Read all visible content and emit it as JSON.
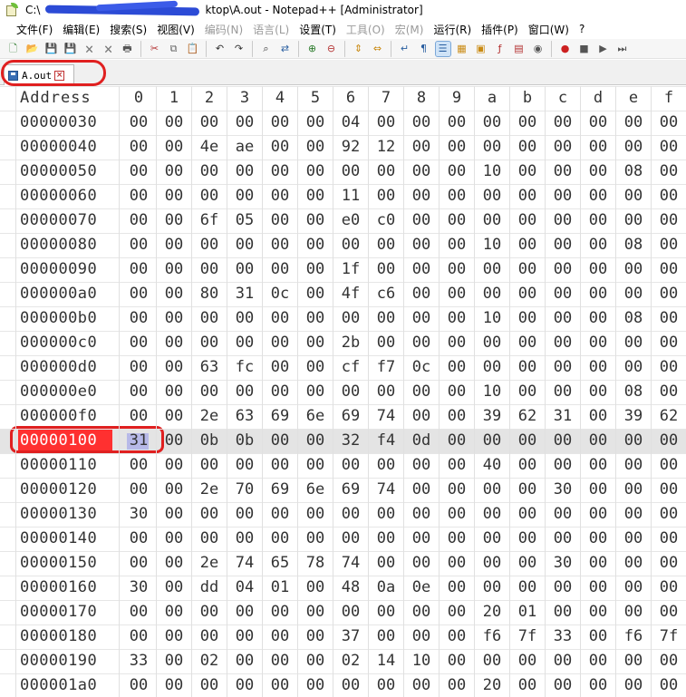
{
  "window": {
    "title_prefix": "C:\\",
    "title_suffix": "ktop\\A.out - Notepad++ [Administrator]"
  },
  "menu": [
    {
      "label": "文件(F)",
      "disabled": false
    },
    {
      "label": "编辑(E)",
      "disabled": false
    },
    {
      "label": "搜索(S)",
      "disabled": false
    },
    {
      "label": "视图(V)",
      "disabled": false
    },
    {
      "label": "编码(N)",
      "disabled": true
    },
    {
      "label": "语言(L)",
      "disabled": true
    },
    {
      "label": "设置(T)",
      "disabled": false
    },
    {
      "label": "工具(O)",
      "disabled": true
    },
    {
      "label": "宏(M)",
      "disabled": true
    },
    {
      "label": "运行(R)",
      "disabled": false
    },
    {
      "label": "插件(P)",
      "disabled": false
    },
    {
      "label": "窗口(W)",
      "disabled": false
    },
    {
      "label": "?",
      "disabled": false
    }
  ],
  "toolbar": [
    {
      "name": "new-file-icon",
      "glyph": "🗋",
      "color": "#2d7a2d"
    },
    {
      "name": "open-file-icon",
      "glyph": "📂",
      "color": "#c98a12"
    },
    {
      "name": "save-icon",
      "glyph": "💾",
      "color": "#7a7a7a"
    },
    {
      "name": "save-all-icon",
      "glyph": "💾",
      "color": "#7a7a7a"
    },
    {
      "name": "close-file-icon",
      "glyph": "🗙",
      "color": "#7a7a7a"
    },
    {
      "name": "close-all-icon",
      "glyph": "🗙",
      "color": "#7a7a7a"
    },
    {
      "name": "print-icon",
      "glyph": "🖶",
      "color": "#555555"
    },
    {
      "name": "sep"
    },
    {
      "name": "cut-icon",
      "glyph": "✂",
      "color": "#b33030"
    },
    {
      "name": "copy-icon",
      "glyph": "⧉",
      "color": "#666666"
    },
    {
      "name": "paste-icon",
      "glyph": "📋",
      "color": "#8a6a2a"
    },
    {
      "name": "sep"
    },
    {
      "name": "undo-icon",
      "glyph": "↶",
      "color": "#333333"
    },
    {
      "name": "redo-icon",
      "glyph": "↷",
      "color": "#333333"
    },
    {
      "name": "sep"
    },
    {
      "name": "find-icon",
      "glyph": "⌕",
      "color": "#333333"
    },
    {
      "name": "replace-icon",
      "glyph": "⇄",
      "color": "#2a5fa0"
    },
    {
      "name": "sep"
    },
    {
      "name": "zoom-in-icon",
      "glyph": "⊕",
      "color": "#2a7a2a"
    },
    {
      "name": "zoom-out-icon",
      "glyph": "⊖",
      "color": "#b33030"
    },
    {
      "name": "sep"
    },
    {
      "name": "sync-vertical-icon",
      "glyph": "⇕",
      "color": "#c98a12"
    },
    {
      "name": "sync-horizontal-icon",
      "glyph": "⇔",
      "color": "#c98a12"
    },
    {
      "name": "sep"
    },
    {
      "name": "word-wrap-icon",
      "glyph": "↵",
      "color": "#2a5fa0"
    },
    {
      "name": "show-all-chars-icon",
      "glyph": "¶",
      "color": "#2a5fa0"
    },
    {
      "name": "indent-guide-icon",
      "glyph": "☰",
      "color": "#2a5fa0",
      "active": true
    },
    {
      "name": "user-lang-icon",
      "glyph": "▦",
      "color": "#c98a12"
    },
    {
      "name": "doc-map-icon",
      "glyph": "▣",
      "color": "#c98a12"
    },
    {
      "name": "function-list-icon",
      "glyph": "ƒ",
      "color": "#b33030"
    },
    {
      "name": "folder-workspace-icon",
      "glyph": "▤",
      "color": "#b33030"
    },
    {
      "name": "monitor-icon",
      "glyph": "◉",
      "color": "#555555"
    },
    {
      "name": "sep"
    },
    {
      "name": "record-macro-icon",
      "glyph": "●",
      "color": "#cc2020"
    },
    {
      "name": "stop-macro-icon",
      "glyph": "■",
      "color": "#555555"
    },
    {
      "name": "play-macro-icon",
      "glyph": "▶",
      "color": "#555555"
    },
    {
      "name": "run-macro-multiple-icon",
      "glyph": "⏭",
      "color": "#555555"
    }
  ],
  "tab": {
    "label": "A.out"
  },
  "hex": {
    "header": [
      "Address",
      "0",
      "1",
      "2",
      "3",
      "4",
      "5",
      "6",
      "7",
      "8",
      "9",
      "a",
      "b",
      "c",
      "d",
      "e",
      "f"
    ],
    "rows": [
      {
        "addr": "00000030",
        "bytes": [
          "00",
          "00",
          "00",
          "00",
          "00",
          "00",
          "04",
          "00",
          "00",
          "00",
          "00",
          "00",
          "00",
          "00",
          "00",
          "00"
        ]
      },
      {
        "addr": "00000040",
        "bytes": [
          "00",
          "00",
          "4e",
          "ae",
          "00",
          "00",
          "92",
          "12",
          "00",
          "00",
          "00",
          "00",
          "00",
          "00",
          "00",
          "00"
        ]
      },
      {
        "addr": "00000050",
        "bytes": [
          "00",
          "00",
          "00",
          "00",
          "00",
          "00",
          "00",
          "00",
          "00",
          "00",
          "10",
          "00",
          "00",
          "00",
          "08",
          "00"
        ]
      },
      {
        "addr": "00000060",
        "bytes": [
          "00",
          "00",
          "00",
          "00",
          "00",
          "00",
          "11",
          "00",
          "00",
          "00",
          "00",
          "00",
          "00",
          "00",
          "00",
          "00"
        ]
      },
      {
        "addr": "00000070",
        "bytes": [
          "00",
          "00",
          "6f",
          "05",
          "00",
          "00",
          "e0",
          "c0",
          "00",
          "00",
          "00",
          "00",
          "00",
          "00",
          "00",
          "00"
        ]
      },
      {
        "addr": "00000080",
        "bytes": [
          "00",
          "00",
          "00",
          "00",
          "00",
          "00",
          "00",
          "00",
          "00",
          "00",
          "10",
          "00",
          "00",
          "00",
          "08",
          "00"
        ]
      },
      {
        "addr": "00000090",
        "bytes": [
          "00",
          "00",
          "00",
          "00",
          "00",
          "00",
          "1f",
          "00",
          "00",
          "00",
          "00",
          "00",
          "00",
          "00",
          "00",
          "00"
        ]
      },
      {
        "addr": "000000a0",
        "bytes": [
          "00",
          "00",
          "80",
          "31",
          "0c",
          "00",
          "4f",
          "c6",
          "00",
          "00",
          "00",
          "00",
          "00",
          "00",
          "00",
          "00"
        ]
      },
      {
        "addr": "000000b0",
        "bytes": [
          "00",
          "00",
          "00",
          "00",
          "00",
          "00",
          "00",
          "00",
          "00",
          "00",
          "10",
          "00",
          "00",
          "00",
          "08",
          "00"
        ]
      },
      {
        "addr": "000000c0",
        "bytes": [
          "00",
          "00",
          "00",
          "00",
          "00",
          "00",
          "2b",
          "00",
          "00",
          "00",
          "00",
          "00",
          "00",
          "00",
          "00",
          "00"
        ]
      },
      {
        "addr": "000000d0",
        "bytes": [
          "00",
          "00",
          "63",
          "fc",
          "00",
          "00",
          "cf",
          "f7",
          "0c",
          "00",
          "00",
          "00",
          "00",
          "00",
          "00",
          "00"
        ]
      },
      {
        "addr": "000000e0",
        "bytes": [
          "00",
          "00",
          "00",
          "00",
          "00",
          "00",
          "00",
          "00",
          "00",
          "00",
          "10",
          "00",
          "00",
          "00",
          "08",
          "00"
        ]
      },
      {
        "addr": "000000f0",
        "bytes": [
          "00",
          "00",
          "2e",
          "63",
          "69",
          "6e",
          "69",
          "74",
          "00",
          "00",
          "39",
          "62",
          "31",
          "00",
          "39",
          "62"
        ]
      },
      {
        "addr": "00000100",
        "bytes": [
          "31",
          "00",
          "0b",
          "0b",
          "00",
          "00",
          "32",
          "f4",
          "0d",
          "00",
          "00",
          "00",
          "00",
          "00",
          "00",
          "00"
        ],
        "highlight": true
      },
      {
        "addr": "00000110",
        "bytes": [
          "00",
          "00",
          "00",
          "00",
          "00",
          "00",
          "00",
          "00",
          "00",
          "00",
          "40",
          "00",
          "00",
          "00",
          "00",
          "00"
        ]
      },
      {
        "addr": "00000120",
        "bytes": [
          "00",
          "00",
          "2e",
          "70",
          "69",
          "6e",
          "69",
          "74",
          "00",
          "00",
          "00",
          "00",
          "30",
          "00",
          "00",
          "00"
        ]
      },
      {
        "addr": "00000130",
        "bytes": [
          "30",
          "00",
          "00",
          "00",
          "00",
          "00",
          "00",
          "00",
          "00",
          "00",
          "00",
          "00",
          "00",
          "00",
          "00",
          "00"
        ]
      },
      {
        "addr": "00000140",
        "bytes": [
          "00",
          "00",
          "00",
          "00",
          "00",
          "00",
          "00",
          "00",
          "00",
          "00",
          "00",
          "00",
          "00",
          "00",
          "00",
          "00"
        ]
      },
      {
        "addr": "00000150",
        "bytes": [
          "00",
          "00",
          "2e",
          "74",
          "65",
          "78",
          "74",
          "00",
          "00",
          "00",
          "00",
          "00",
          "30",
          "00",
          "00",
          "00"
        ]
      },
      {
        "addr": "00000160",
        "bytes": [
          "30",
          "00",
          "dd",
          "04",
          "01",
          "00",
          "48",
          "0a",
          "0e",
          "00",
          "00",
          "00",
          "00",
          "00",
          "00",
          "00"
        ]
      },
      {
        "addr": "00000170",
        "bytes": [
          "00",
          "00",
          "00",
          "00",
          "00",
          "00",
          "00",
          "00",
          "00",
          "00",
          "20",
          "01",
          "00",
          "00",
          "00",
          "00"
        ]
      },
      {
        "addr": "00000180",
        "bytes": [
          "00",
          "00",
          "00",
          "00",
          "00",
          "00",
          "37",
          "00",
          "00",
          "00",
          "f6",
          "7f",
          "33",
          "00",
          "f6",
          "7f"
        ]
      },
      {
        "addr": "00000190",
        "bytes": [
          "33",
          "00",
          "02",
          "00",
          "00",
          "00",
          "02",
          "14",
          "10",
          "00",
          "00",
          "00",
          "00",
          "00",
          "00",
          "00"
        ]
      },
      {
        "addr": "000001a0",
        "bytes": [
          "00",
          "00",
          "00",
          "00",
          "00",
          "00",
          "00",
          "00",
          "00",
          "00",
          "20",
          "00",
          "00",
          "00",
          "00",
          "00"
        ]
      }
    ]
  }
}
